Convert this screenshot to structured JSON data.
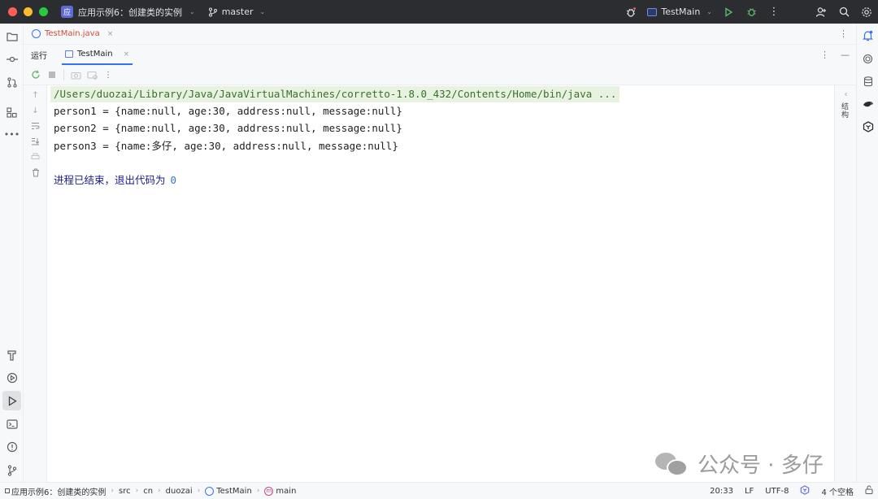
{
  "titlebar": {
    "project_badge": "应",
    "project_name": "应用示例6：创建类的实例",
    "branch": "master",
    "run_config": "TestMain"
  },
  "editor_tabs": [
    {
      "label": "TestMain.java",
      "close": "×"
    }
  ],
  "run_panel": {
    "title": "运行",
    "tab_label": "TestMain",
    "tab_close": "×"
  },
  "console": {
    "command": "/Users/duozai/Library/Java/JavaVirtualMachines/corretto-1.8.0_432/Contents/Home/bin/java ...",
    "lines": [
      "person1 = {name:null, age:30, address:null, message:null}",
      "person2 = {name:null, age:30, address:null, message:null}",
      "person3 = {name:多仔, age:30, address:null, message:null}"
    ],
    "exit_text": "进程已结束，退出代码为",
    "exit_code": "0"
  },
  "console_gutter": {
    "label": "结构"
  },
  "watermark": {
    "text": "公众号 · 多仔"
  },
  "statusbar": {
    "breadcrumbs": [
      "应用示例6：创建类的实例",
      "src",
      "cn",
      "duozai",
      "TestMain",
      "main"
    ],
    "position": "20:33",
    "line_ending": "LF",
    "encoding": "UTF-8",
    "indent": "4 个空格"
  },
  "colors": {
    "accent": "#3574f0",
    "command_bg": "#e8f2e0",
    "exit_text": "#1b1b8f",
    "titlebar_bg": "#2b2d30"
  }
}
